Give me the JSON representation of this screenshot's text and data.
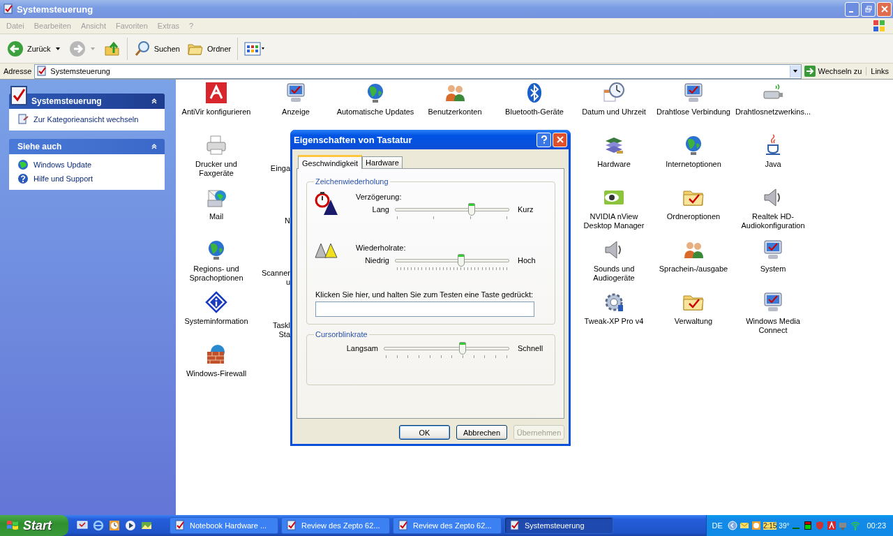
{
  "window": {
    "title": "Systemsteuerung"
  },
  "menu": [
    "Datei",
    "Bearbeiten",
    "Ansicht",
    "Favoriten",
    "Extras",
    "?"
  ],
  "toolbar": {
    "back": "Zurück",
    "search": "Suchen",
    "folders": "Ordner",
    "forward_disabled": true
  },
  "address": {
    "label": "Adresse",
    "value": "Systemsteuerung",
    "go": "Wechseln zu",
    "links": "Links"
  },
  "sidebar": [
    {
      "title": "Systemsteuerung",
      "items": [
        "Zur Kategorieansicht wechseln"
      ]
    },
    {
      "title": "Siehe auch",
      "items": [
        "Windows Update",
        "Hilfe und Support"
      ]
    }
  ],
  "icon_rows": [
    [
      {
        "label": "AntiVir konfigurieren",
        "kind": "full"
      },
      {
        "label": "Anzeige",
        "kind": "full"
      },
      {
        "label": "Automatische Updates",
        "kind": "full"
      },
      {
        "label": "Benutzerkonten",
        "kind": "full"
      },
      {
        "label": "Bluetooth-Geräte",
        "kind": "full"
      },
      {
        "label": "Datum und Uhrzeit",
        "kind": "full"
      },
      {
        "label": "Drahtlose Verbindung",
        "kind": "full"
      },
      {
        "label": "Drahtlosnetzwerkins...",
        "kind": "full"
      }
    ],
    [
      {
        "label": "Drucker und Faxgeräte",
        "kind": "full"
      },
      {
        "label": "Einga",
        "kind": "cut"
      },
      {
        "label": "Hardware",
        "kind": "full"
      },
      {
        "label": "Internetoptionen",
        "kind": "full"
      },
      {
        "label": "Java",
        "kind": "full"
      }
    ],
    [
      {
        "label": "Mail",
        "kind": "full"
      },
      {
        "label": "N",
        "kind": "cut"
      },
      {
        "label": "NVIDIA nView Desktop Manager",
        "kind": "full"
      },
      {
        "label": "Ordneroptionen",
        "kind": "full"
      },
      {
        "label": "Realtek HD-Audiokonfiguration",
        "kind": "full"
      }
    ],
    [
      {
        "label": "Regions- und Sprachoptionen",
        "kind": "full"
      },
      {
        "label": "Scanner u",
        "kind": "cut"
      },
      {
        "label": "Sounds und Audiogeräte",
        "kind": "full"
      },
      {
        "label": "Sprachein-/ausgabe",
        "kind": "full"
      },
      {
        "label": "System",
        "kind": "full"
      }
    ],
    [
      {
        "label": "Systeminformation",
        "kind": "full"
      },
      {
        "label": "Taskl\nSta",
        "kind": "cut"
      },
      {
        "label": "Tweak-XP Pro v4",
        "kind": "full"
      },
      {
        "label": "Verwaltung",
        "kind": "full"
      },
      {
        "label": "Windows Media Connect",
        "kind": "full"
      }
    ],
    [
      {
        "label": "Windows-Firewall",
        "kind": "full"
      }
    ]
  ],
  "dialog": {
    "title": "Eigenschaften von Tastatur",
    "tabs": [
      {
        "label": "Geschwindigkeit",
        "selected": true
      },
      {
        "label": "Hardware",
        "selected": false
      }
    ],
    "groups": [
      {
        "title": "Zeichenwiederholung",
        "sliders": [
          {
            "label": "Verzögerung:",
            "low": "Lang",
            "high": "Kurz",
            "level": 0.67
          },
          {
            "label": "Wiederholrate:",
            "low": "Niedrig",
            "high": "Hoch",
            "level": 0.58
          }
        ],
        "test_label": "Klicken Sie hier, und halten Sie zum Testen eine Taste gedrückt:"
      },
      {
        "title": "Cursorblinkrate",
        "sliders": [
          {
            "low": "Langsam",
            "high": "Schnell",
            "level": 0.63
          }
        ]
      }
    ],
    "buttons": [
      {
        "label": "OK",
        "default": true,
        "disabled": false
      },
      {
        "label": "Abbrechen",
        "default": false,
        "disabled": false
      },
      {
        "label": "Übernehmen",
        "default": false,
        "disabled": true
      }
    ]
  },
  "taskbar": {
    "start": "Start",
    "tasks": [
      {
        "label": "Notebook Hardware ...",
        "selected": false
      },
      {
        "label": "Review des Zepto 62...",
        "selected": false
      },
      {
        "label": "Review des Zepto 62...",
        "selected": false
      },
      {
        "label": "Systemsteuerung",
        "selected": true
      }
    ],
    "language": "DE",
    "tray_time": "2:15",
    "temperature": "39°",
    "clock": "00:23"
  }
}
